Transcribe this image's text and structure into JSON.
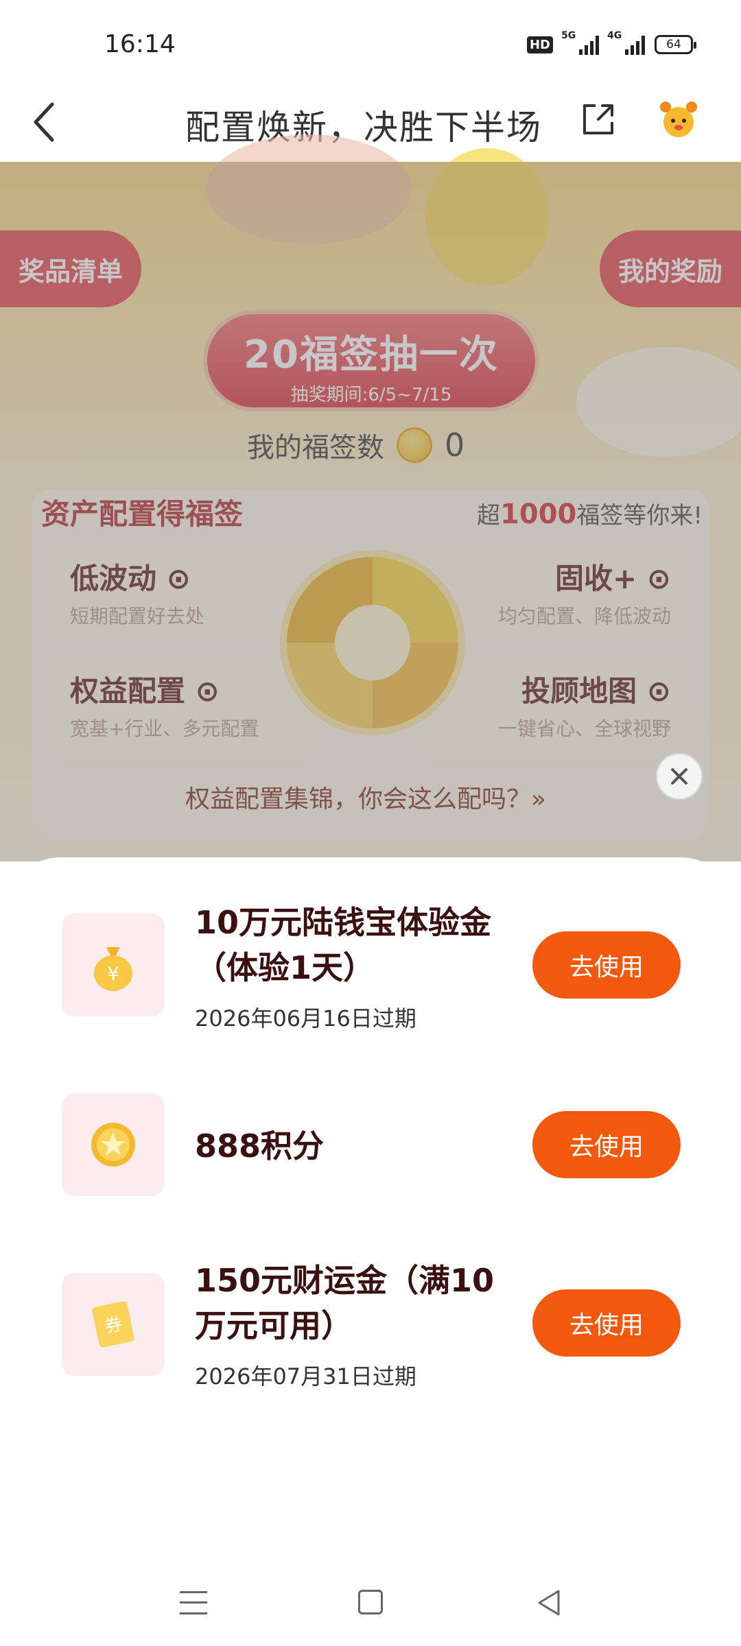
{
  "status_bar": {
    "time": "16:14",
    "hd_label": "HD",
    "signal_1_label": "5G",
    "signal_2_label": "4G",
    "battery": "64"
  },
  "nav": {
    "title": "配置焕新，决胜下半场"
  },
  "campaign": {
    "prize_list_label": "奖品清单",
    "my_rewards_label": "我的奖励",
    "draw_button_title": "20福签抽一次",
    "draw_period": "抽奖期间:6/5~7/15",
    "my_count_label": "我的福签数",
    "my_count_value": "0",
    "asset_title": "资产配置得福签",
    "asset_note_prefix": "超",
    "asset_note_highlight": "1000",
    "asset_note_suffix": "福签等你来!",
    "cells": [
      {
        "title": "低波动 ⊙",
        "sub": "短期配置好去处"
      },
      {
        "title": "固收+ ⊙",
        "sub": "均匀配置、降低波动"
      },
      {
        "title": "权益配置 ⊙",
        "sub": "宽基+行业、多元配置"
      },
      {
        "title": "投顾地图 ⊙",
        "sub": "一键省心、全球视野"
      }
    ],
    "highlight_link": "权益配置集锦，你会这么配吗？»"
  },
  "rewards": [
    {
      "title": "10万元陆钱宝体验金（体验1天）",
      "expiry": "2026年06月16日过期",
      "button": "去使用",
      "icon": "money-bag-icon"
    },
    {
      "title": "888积分",
      "expiry": "",
      "button": "去使用",
      "icon": "coin-star-icon"
    },
    {
      "title": "150元财运金（满10万元可用）",
      "expiry": "2026年07月31日过期",
      "button": "去使用",
      "icon": "coupon-icon"
    }
  ],
  "colors": {
    "accent": "#f2590f",
    "campaign_red": "#d9303a"
  }
}
